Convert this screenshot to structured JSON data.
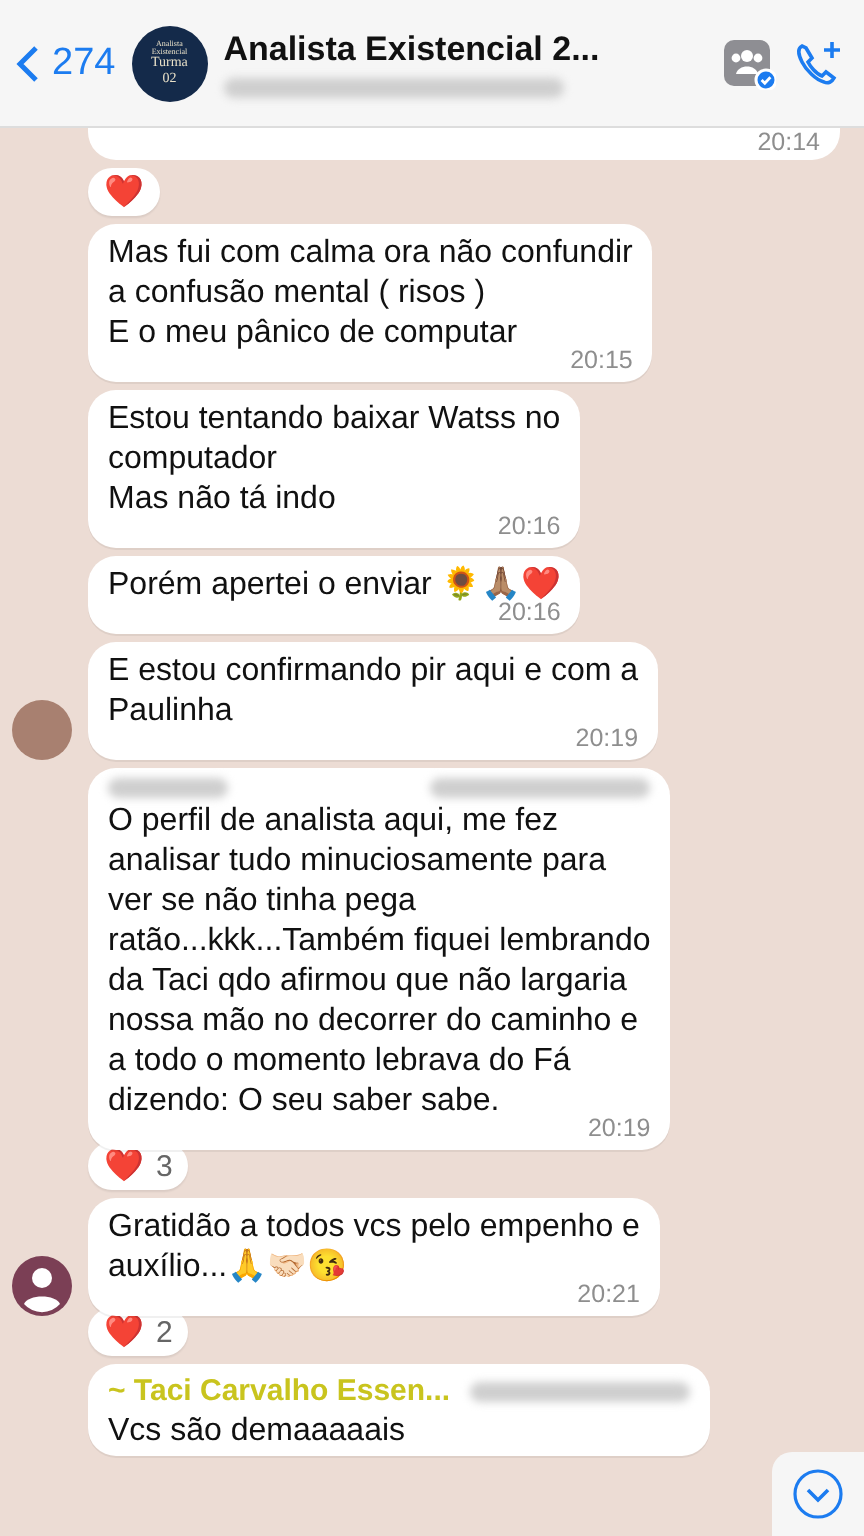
{
  "header": {
    "back_count": "274",
    "title": "Analista Existencial 2...",
    "subtitle_hidden": true,
    "avatar_lines": [
      "Analista",
      "Existencial",
      "Turma",
      "02"
    ]
  },
  "top_partial": {
    "time": "20:14",
    "reaction": {
      "emoji": "❤️"
    }
  },
  "messages": [
    {
      "kind": "text",
      "text": "Mas fui com calma ora não confundir\na confusão mental ( risos )\nE o meu pânico de computar",
      "time": "20:15"
    },
    {
      "kind": "text",
      "text": "Estou tentando baixar Watss no\ncomputador\nMas não tá indo",
      "time": "20:16"
    },
    {
      "kind": "text",
      "text": "Porém apertei o enviar 🌻🙏🏽❤️",
      "time": "20:16"
    },
    {
      "kind": "text",
      "text": "E estou confirmando pir aqui e com a\nPaulinha",
      "time": "20:19",
      "avatar": {
        "kind": "photo"
      }
    },
    {
      "kind": "text",
      "sender": {
        "blurred": true,
        "phone_hidden": true
      },
      "text": "O perfil de analista aqui, me fez\nanalisar tudo minuciosamente para\nver se não tinha pega\nratão...kkk...Também fiquei lembrando\nda Taci qdo afirmou que não largaria\nnossa mão no decorrer do caminho e\na todo o momento lebrava do Fá\ndizendo: O seu saber sabe.",
      "time": "20:19",
      "reaction": {
        "emoji": "❤️",
        "count": "3"
      }
    },
    {
      "kind": "text",
      "text": "Gratidão a todos vcs pelo empenho e\nauxílio...🙏🤝🏻😘",
      "time": "20:21",
      "avatar": {
        "kind": "generic"
      },
      "reaction": {
        "emoji": "❤️",
        "count": "2"
      }
    },
    {
      "kind": "partial",
      "sender": {
        "name": "~ Taci Carvalho Essen...",
        "color": "#c9c41e",
        "phone_hidden": true
      },
      "text": "Vcs são demaaaaais"
    }
  ]
}
